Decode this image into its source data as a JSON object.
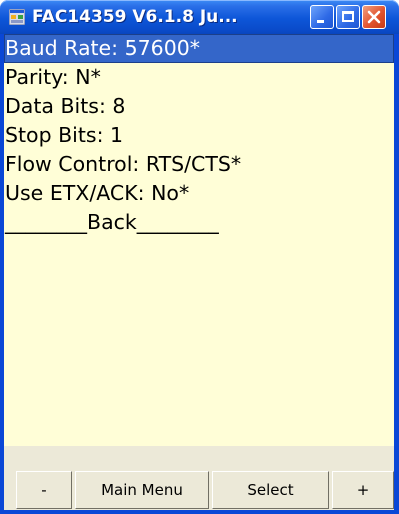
{
  "window": {
    "title": "FAC14359 V6.1.8 Ju..."
  },
  "menu": {
    "items": [
      {
        "label": "Baud Rate: 57600*",
        "selected": true
      },
      {
        "label": "Parity: N*",
        "selected": false
      },
      {
        "label": "Data Bits: 8",
        "selected": false
      },
      {
        "label": "Stop Bits: 1",
        "selected": false
      },
      {
        "label": "Flow Control: RTS/CTS*",
        "selected": false
      },
      {
        "label": "Use ETX/ACK: No*",
        "selected": false
      },
      {
        "label": "________Back________",
        "selected": false
      }
    ]
  },
  "softkeys": {
    "minus": "-",
    "main_menu": "Main Menu",
    "select": "Select",
    "plus": "+"
  },
  "colors": {
    "titlebar": "#0a4ccb",
    "client_bg": "#fffed7",
    "selection": "#3466c9",
    "softkey_bar": "#ece9d8",
    "close_button": "#e2542f"
  },
  "icons": [
    "app-icon",
    "minimize-icon",
    "maximize-icon",
    "close-icon"
  ]
}
